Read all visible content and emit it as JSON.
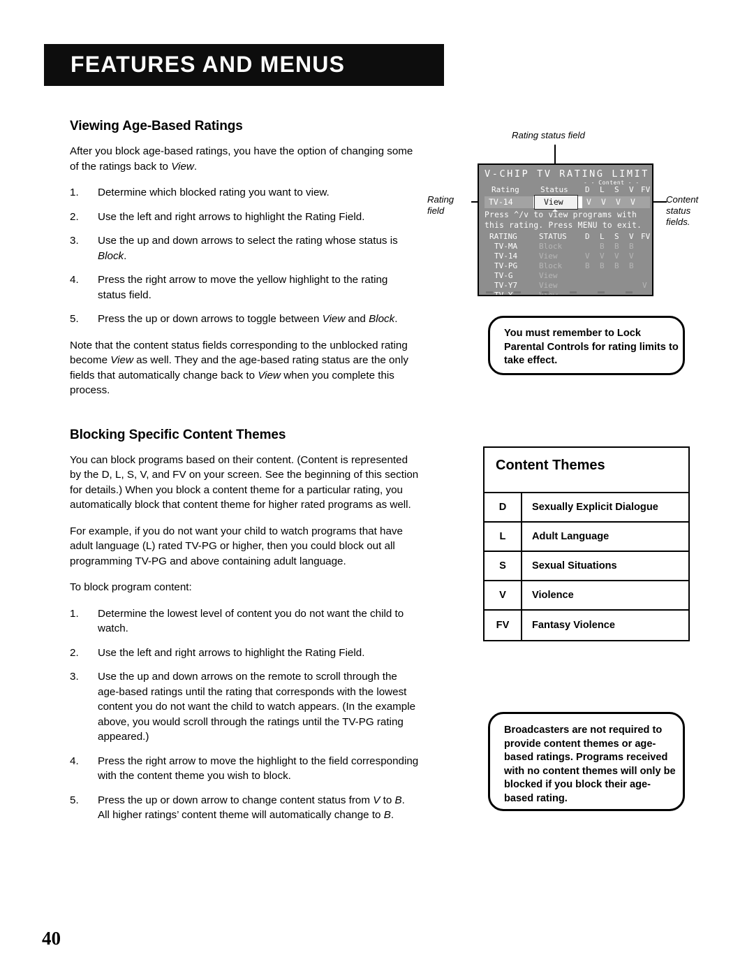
{
  "header": {
    "banner_title": "FEATURES AND MENUS"
  },
  "page_number": "40",
  "left_column": {
    "section1": {
      "heading": "Viewing Age-Based Ratings",
      "intro": "After you block age-based ratings, you have the option of changing some of the ratings back to View.",
      "steps": [
        {
          "num": "1.",
          "text": "Determine which blocked rating you want to view."
        },
        {
          "num": "2.",
          "text": "Use the left and right arrows to highlight the Rating Field."
        },
        {
          "num": "3.",
          "text": "Use the up and down arrows to select the rating whose status is Block."
        },
        {
          "num": "4.",
          "text": "Press the right arrow to move the yellow highlight to the rating status field."
        },
        {
          "num": "5.",
          "text": "Press the up or down arrows to toggle between View and Block."
        }
      ],
      "note": "Note that the content status fields corresponding to the unblocked rating become View as well. They and the age-based rating status are the only fields that automatically change back to View when you complete this process."
    },
    "section2": {
      "heading": "Blocking Specific Content Themes",
      "para1": "You can block programs based on their content. (Content is represented by the D, L, S, V, and FV on your screen. See the beginning of this section for details.) When you block a content theme for a particular rating, you automatically block that content theme for higher rated programs as well.",
      "para2": "For example, if you do not want your child to watch programs that have adult language (L) rated TV-PG or higher, then you could block out all programming TV-PG and above containing adult language.",
      "para3": "To block program content:",
      "steps": [
        {
          "num": "1.",
          "text": "Determine the lowest level of content you do not want the child to watch."
        },
        {
          "num": "2.",
          "text": "Use the left and right arrows to highlight the Rating Field."
        },
        {
          "num": "3.",
          "text": "Use the up and down arrows on the remote to scroll through the age-based ratings until the rating that corresponds with the lowest content you do not want the child to watch appears.  (In the example above, you would scroll through the ratings until the TV-PG rating appeared.)"
        },
        {
          "num": "4.",
          "text": "Press the right arrow to move the highlight to the field corresponding with the content theme you wish to block."
        },
        {
          "num": "5.",
          "text": "Press the up or down arrow to change content status from V to B. All higher ratings' content theme will automatically change to B."
        }
      ]
    }
  },
  "tv_figure": {
    "callouts": {
      "rating_status_field": "Rating status field",
      "rating_field_line1": "Rating",
      "rating_field_line2": "field",
      "content_status_line1": "Content",
      "content_status_line2": "status",
      "content_status_line3": "fields."
    },
    "screen": {
      "title": "V-CHIP TV RATING LIMIT",
      "content_group_label": "- - Content - -",
      "header_rating": "Rating",
      "header_status": "Status",
      "content_codes": [
        "D",
        "L",
        "S",
        "V",
        "FV"
      ],
      "selection": {
        "rating": "TV-14",
        "status": "View",
        "content_values": [
          "V",
          "V",
          "V",
          "V"
        ]
      },
      "instruction_line1": "Press ^/v to view programs with",
      "instruction_line2": "this rating. Press MENU to exit.",
      "table_headers": {
        "rating": "RATING",
        "status": "STATUS",
        "codes": [
          "D",
          "L",
          "S",
          "V",
          "FV"
        ]
      },
      "table_rows": [
        {
          "rating": "TV-MA",
          "status": "Block",
          "codes": [
            "",
            "B",
            "B",
            "B",
            ""
          ]
        },
        {
          "rating": "TV-14",
          "status": "View",
          "codes": [
            "V",
            "V",
            "V",
            "V",
            ""
          ]
        },
        {
          "rating": "TV-PG",
          "status": "Block",
          "codes": [
            "B",
            "B",
            "B",
            "B",
            ""
          ]
        },
        {
          "rating": "TV-G",
          "status": "View",
          "codes": [
            "",
            "",
            "",
            "",
            ""
          ]
        },
        {
          "rating": "TV-Y7",
          "status": "View",
          "codes": [
            "",
            "",
            "",
            "",
            "V"
          ]
        },
        {
          "rating": "TV-Y",
          "status": "View",
          "codes": [
            "",
            "",
            "",
            "",
            ""
          ]
        }
      ]
    },
    "colors": {
      "screen_bg": "#8e8e8e",
      "highlight_bg": "#a3a3a3",
      "status_box_bg": "#f2f2f2",
      "bar_bg": "#ffffff",
      "dim_text": "#b7b7b7"
    }
  },
  "notes": {
    "lock": "You must remember to Lock Parental Controls for rating limits to take effect.",
    "broadcasters": "Broadcasters are not required to provide content themes or age-based ratings. Programs received with no content themes will only be blocked if you block their age-based rating."
  },
  "content_themes": {
    "title": "Content Themes",
    "rows": [
      {
        "code": "D",
        "desc": "Sexually Explicit Dialogue"
      },
      {
        "code": "L",
        "desc": "Adult Language"
      },
      {
        "code": "S",
        "desc": "Sexual Situations"
      },
      {
        "code": "V",
        "desc": "Violence"
      },
      {
        "code": "FV",
        "desc": "Fantasy Violence"
      }
    ]
  }
}
